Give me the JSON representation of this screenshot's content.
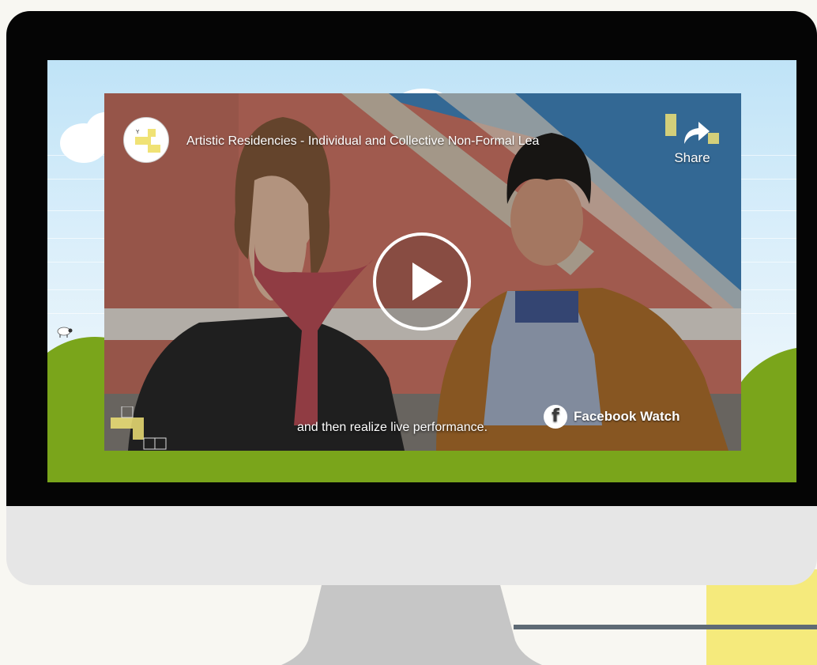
{
  "video": {
    "title": "Artistic Residencies - Individual and Collective Non-Formal Lea",
    "share_label": "Share",
    "subtitle": "and then realize live performance.",
    "platform_label": "Facebook Watch",
    "icons": {
      "share": "share-arrow-icon",
      "play": "play-icon",
      "platform": "facebook-icon",
      "channel": "channel-logo"
    }
  },
  "colors": {
    "accent_yellow": "#f5ea7c",
    "grass_green": "#7aa51b",
    "bezel": "#050505",
    "chin": "#e6e6e6"
  }
}
